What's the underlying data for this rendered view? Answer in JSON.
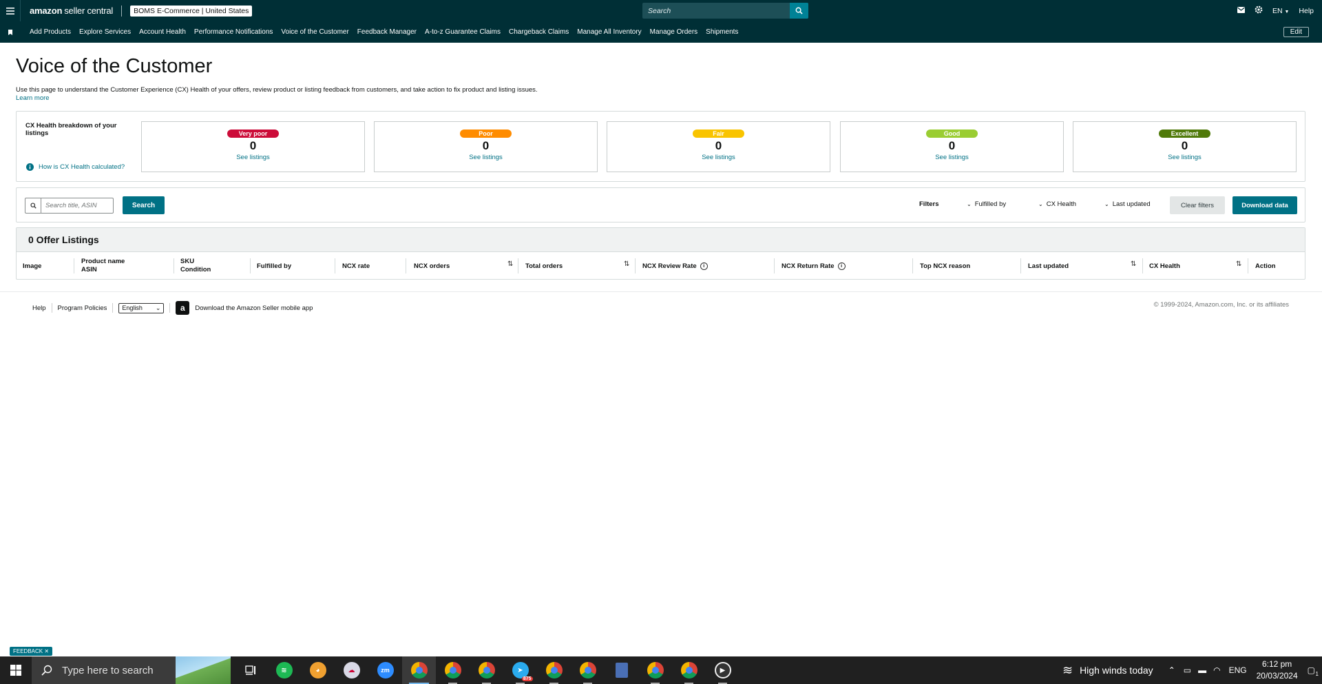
{
  "topbar": {
    "logo_brand": "amazon",
    "logo_product": "seller central",
    "account": "BOMS E-Commerce | United States",
    "search_placeholder": "Search",
    "language": "EN",
    "help": "Help"
  },
  "nav": {
    "items": [
      "Add Products",
      "Explore Services",
      "Account Health",
      "Performance Notifications",
      "Voice of the Customer",
      "Feedback Manager",
      "A-to-z Guarantee Claims",
      "Chargeback Claims",
      "Manage All Inventory",
      "Manage Orders",
      "Shipments"
    ],
    "edit": "Edit"
  },
  "page": {
    "title": "Voice of the Customer",
    "intro": "Use this page to understand the Customer Experience (CX) Health of your offers, review product or listing feedback from customers, and take action to fix product and listing issues.",
    "learn_more": "Learn more"
  },
  "cx_health": {
    "title": "CX Health breakdown of your listings",
    "how_link": "How is CX Health calculated?",
    "cards": [
      {
        "label": "Very poor",
        "count": "0",
        "link": "See listings",
        "color": "#cc0c39"
      },
      {
        "label": "Poor",
        "count": "0",
        "link": "See listings",
        "color": "#ff8c00"
      },
      {
        "label": "Fair",
        "count": "0",
        "link": "See listings",
        "color": "#f9c400"
      },
      {
        "label": "Good",
        "count": "0",
        "link": "See listings",
        "color": "#9acd32"
      },
      {
        "label": "Excellent",
        "count": "0",
        "link": "See listings",
        "color": "#507a0a"
      }
    ]
  },
  "filters": {
    "search_placeholder": "Search title, ASIN",
    "search_button": "Search",
    "label": "Filters",
    "dropdowns": [
      "Fulfilled by",
      "CX Health",
      "Last updated"
    ],
    "clear": "Clear filters",
    "download": "Download data"
  },
  "table": {
    "heading": "0 Offer Listings",
    "columns": {
      "image": "Image",
      "product_name": "Product name",
      "asin": "ASIN",
      "sku": "SKU",
      "condition": "Condition",
      "fulfilled_by": "Fulfilled by",
      "ncx_rate": "NCX rate",
      "ncx_orders": "NCX orders",
      "total_orders": "Total orders",
      "ncx_review_rate": "NCX Review Rate",
      "ncx_return_rate": "NCX Return Rate",
      "top_ncx_reason": "Top NCX reason",
      "last_updated": "Last updated",
      "cx_health": "CX Health",
      "action": "Action"
    }
  },
  "footer": {
    "help": "Help",
    "policies": "Program Policies",
    "language": "English",
    "app_link": "Download the Amazon Seller mobile app",
    "copyright": "© 1999-2024, Amazon.com, Inc. or its affiliates"
  },
  "feedback_tab": "FEEDBACK",
  "taskbar": {
    "search_placeholder": "Type here to search",
    "weather": "High winds today",
    "lang": "ENG",
    "time": "6:12 pm",
    "date": "20/03/2024",
    "notification_count": "1",
    "telegram_badge": "875"
  }
}
